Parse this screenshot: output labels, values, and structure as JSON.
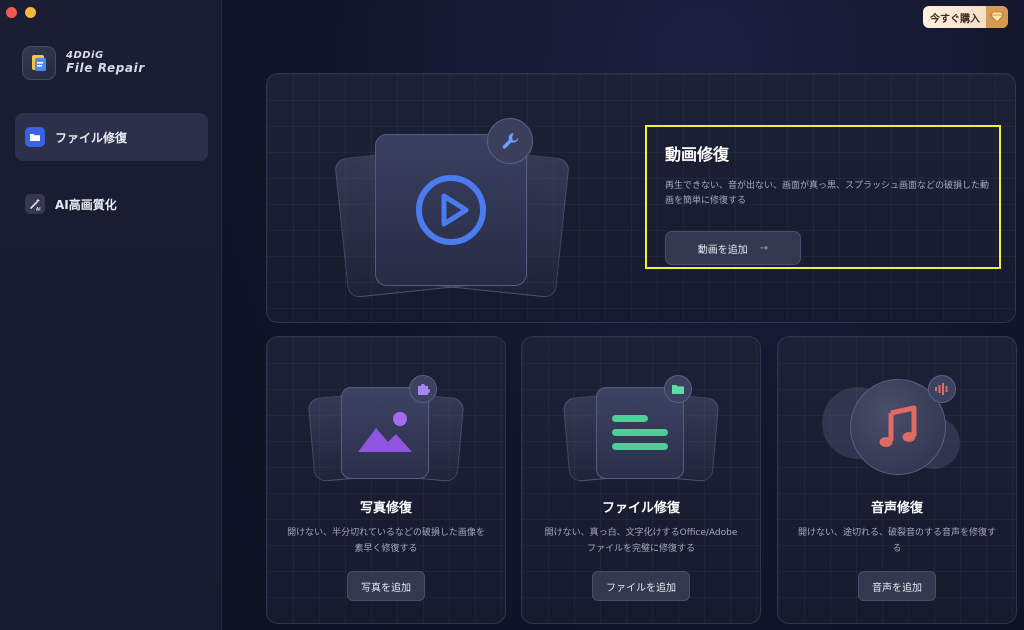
{
  "app": {
    "brand_name": "4DDiG",
    "product_name": "File Repair"
  },
  "sidebar": {
    "items": [
      {
        "label": "ファイル修復",
        "icon": "folder-icon",
        "active": true
      },
      {
        "label": "AI高画質化",
        "icon": "magic-wand-icon",
        "active": false
      }
    ]
  },
  "header": {
    "buy_label": "今すぐ購入",
    "buy_icon": "diamond-icon"
  },
  "hero": {
    "title": "動画修復",
    "description": "再生できない、音が出ない、画面が真っ黒、スプラッシュ画面などの破損した動画を簡単に修復する",
    "button_label": "動画を追加",
    "button_arrow": "→",
    "icon": "play-icon",
    "badge_icon": "wrench-icon"
  },
  "cards": [
    {
      "title": "写真修復",
      "description": "開けない、半分切れているなどの破損した画像を素早く修復する",
      "button_label": "写真を追加",
      "icon": "image-icon",
      "badge_icon": "puzzle-icon"
    },
    {
      "title": "ファイル修復",
      "description": "開けない、真っ白、文字化けするOffice/Adobeファイルを完璧に修復する",
      "button_label": "ファイルを追加",
      "icon": "document-icon",
      "badge_icon": "folder-icon"
    },
    {
      "title": "音声修復",
      "description": "開けない、途切れる、破裂音のする音声を修復する",
      "button_label": "音声を追加",
      "icon": "music-note-icon",
      "badge_icon": "audio-wave-icon"
    }
  ],
  "colors": {
    "accent_blue": "#3b62e0",
    "highlight_yellow": "#eef03d",
    "image_purple": "#9b5de5",
    "document_green": "#4ecf9a",
    "music_red": "#e06b63"
  }
}
